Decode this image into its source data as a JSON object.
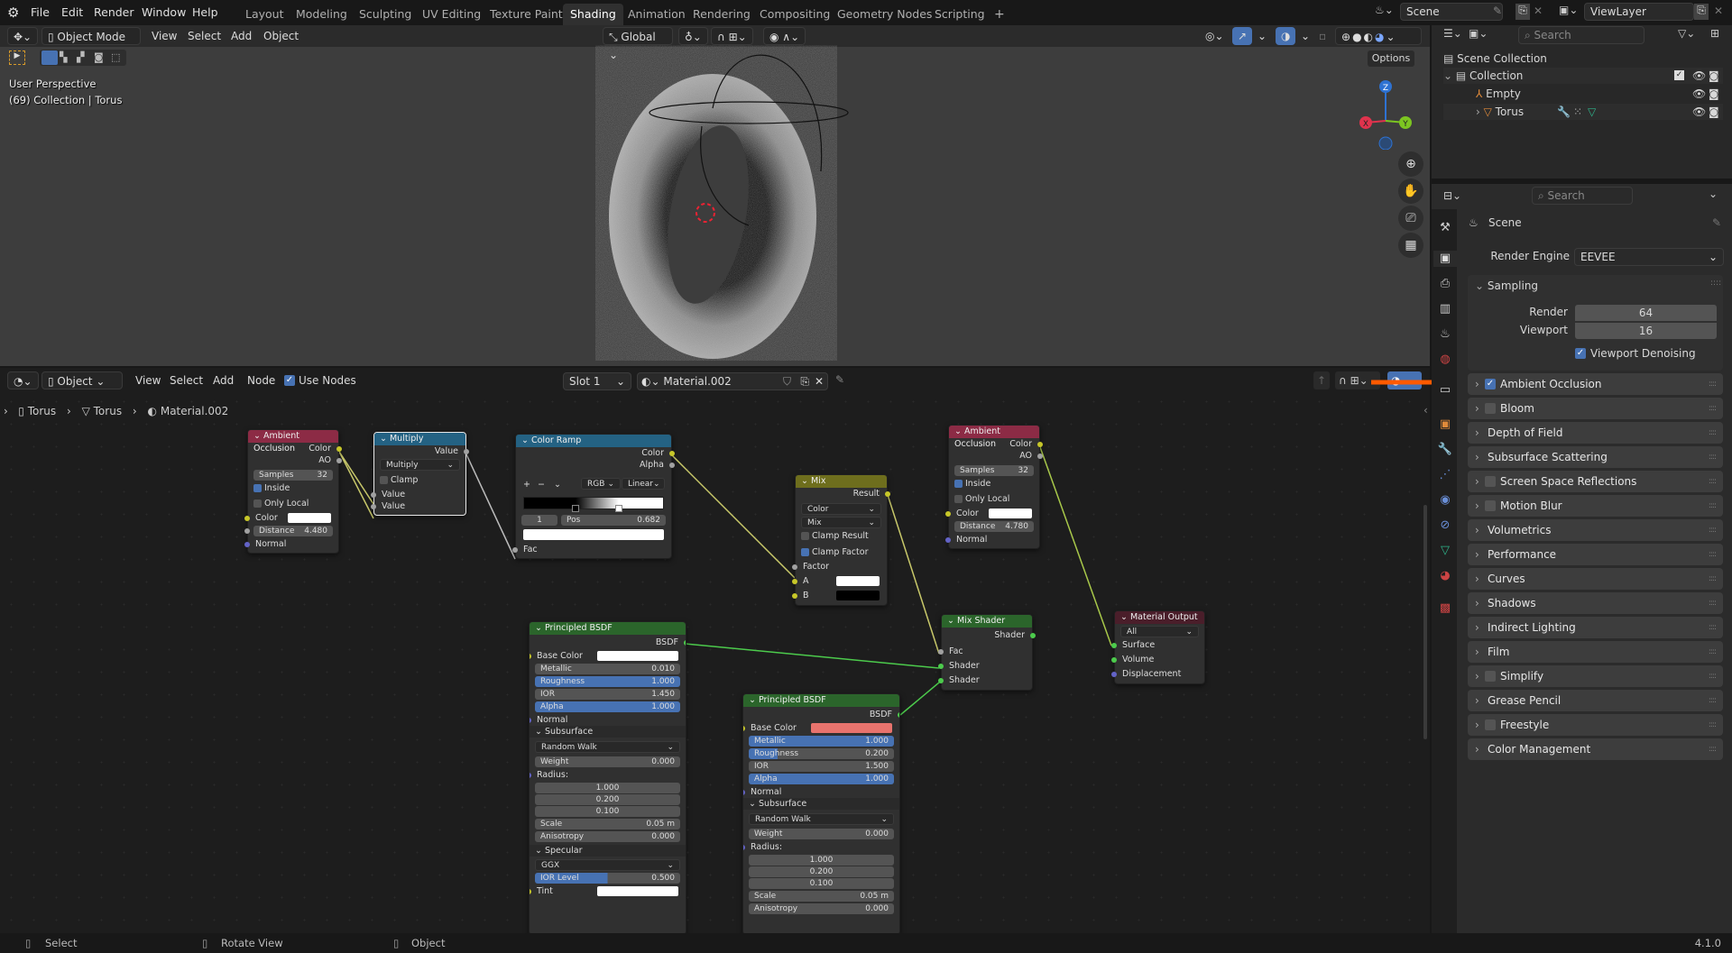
{
  "topbar": {
    "menus": [
      "File",
      "Edit",
      "Render",
      "Window",
      "Help"
    ],
    "workspaces": [
      "Layout",
      "Modeling",
      "Sculpting",
      "UV Editing",
      "Texture Paint",
      "Shading",
      "Animation",
      "Rendering",
      "Compositing",
      "Geometry Nodes",
      "Scripting"
    ],
    "active_workspace": "Shading",
    "add_tab": "+",
    "scene": "Scene",
    "view_layer": "ViewLayer"
  },
  "viewport": {
    "mode": "Object Mode",
    "menus": [
      "View",
      "Select",
      "Add",
      "Object"
    ],
    "transform_orientation": "Global",
    "options_label": "Options",
    "overlay_title": "User Perspective",
    "overlay_subtitle": "(69) Collection | Torus",
    "gizmo_axes": [
      "X",
      "Y",
      "Z"
    ]
  },
  "node_editor": {
    "editor_type": "Object",
    "menus": [
      "View",
      "Select",
      "Add",
      "Node"
    ],
    "use_nodes_label": "Use Nodes",
    "use_nodes_checked": true,
    "slot": "Slot 1",
    "material": "Material.002",
    "breadcrumb": [
      "Torus",
      "Torus",
      "Material.002"
    ],
    "nodes": {
      "ao1": {
        "title": "Ambient Occlusion",
        "out": [
          "Color",
          "AO"
        ],
        "samples_label": "Samples",
        "samples": "32",
        "inside": "Inside",
        "inside_checked": true,
        "only_local": "Only Local",
        "only_local_checked": false,
        "color_label": "Color",
        "distance_label": "Distance",
        "distance": "4.480",
        "normal": "Normal"
      },
      "multiply": {
        "title": "Multiply",
        "out": "Value",
        "op": "Multiply",
        "clamp": "Clamp",
        "in": [
          "Value",
          "Value"
        ]
      },
      "ramp": {
        "title": "Color Ramp",
        "out": [
          "Color",
          "Alpha"
        ],
        "color_mode": "RGB",
        "interp": "Linear",
        "stop_index": "1",
        "pos_label": "Pos",
        "pos": "0.682",
        "fac": "Fac",
        "stops": [
          0.37,
          0.682
        ]
      },
      "mix": {
        "title": "Mix",
        "out": "Result",
        "data_type": "Color",
        "blend": "Mix",
        "clamp_result": "Clamp Result",
        "clamp_factor": "Clamp Factor",
        "factor": "Factor",
        "a": "A",
        "b": "B"
      },
      "ao2": {
        "title": "Ambient Occlusion",
        "out": [
          "Color",
          "AO"
        ],
        "samples_label": "Samples",
        "samples": "32",
        "inside": "Inside",
        "only_local": "Only Local",
        "color_label": "Color",
        "distance_label": "Distance",
        "distance": "4.780",
        "normal": "Normal"
      },
      "mixshader": {
        "title": "Mix Shader",
        "out": "Shader",
        "in": [
          "Fac",
          "Shader",
          "Shader"
        ]
      },
      "output": {
        "title": "Material Output",
        "target": "All",
        "in": [
          "Surface",
          "Volume",
          "Displacement"
        ]
      },
      "bsdf1": {
        "title": "Principled BSDF",
        "out": "BSDF",
        "base_color": "Base Color",
        "base_color_hex": "#ffffff",
        "metallic": "0.010",
        "roughness": "1.000",
        "ior": "1.450",
        "alpha": "1.000",
        "normal": "Normal",
        "subsurface": "Subsurface",
        "ss_method": "Random Walk",
        "weight": "0.000",
        "radius": "Radius:",
        "radius_vals": [
          "1.000",
          "0.200",
          "0.100"
        ],
        "scale": "0.05 m",
        "anisotropy": "0.000",
        "specular": "Specular",
        "distribution": "GGX",
        "ior_level": "0.500",
        "ior_level_frac": 0.5,
        "tint": "Tint",
        "labels": {
          "metallic": "Metallic",
          "roughness": "Roughness",
          "ior": "IOR",
          "alpha": "Alpha",
          "weight": "Weight",
          "scale": "Scale",
          "anisotropy": "Anisotropy",
          "ior_level": "IOR Level"
        }
      },
      "bsdf2": {
        "title": "Principled BSDF",
        "out": "BSDF",
        "base_color": "Base Color",
        "base_color_hex": "#e8736d",
        "metallic": "1.000",
        "roughness": "0.200",
        "ior": "1.500",
        "alpha": "1.000",
        "normal": "Normal",
        "subsurface": "Subsurface",
        "ss_method": "Random Walk",
        "weight": "0.000",
        "radius": "Radius:",
        "radius_vals": [
          "1.000",
          "0.200",
          "0.100"
        ],
        "scale": "0.05 m",
        "anisotropy": "0.000",
        "labels": {
          "metallic": "Metallic",
          "roughness": "Roughness",
          "ior": "IOR",
          "alpha": "Alpha",
          "weight": "Weight",
          "scale": "Scale",
          "anisotropy": "Anisotropy"
        }
      }
    }
  },
  "outliner": {
    "search_placeholder": "Search",
    "items": [
      {
        "label": "Scene Collection",
        "icon": "collection-icon"
      },
      {
        "label": "Collection",
        "icon": "collection-icon"
      },
      {
        "label": "Empty",
        "icon": "empty-icon"
      },
      {
        "label": "Torus",
        "icon": "mesh-icon"
      }
    ]
  },
  "properties": {
    "search_placeholder": "Search",
    "context": "Scene",
    "render_engine_label": "Render Engine",
    "render_engine": "EEVEE",
    "sampling": {
      "title": "Sampling",
      "render_label": "Render",
      "render": "64",
      "viewport_label": "Viewport",
      "viewport": "16",
      "denoise_label": "Viewport Denoising",
      "denoise_checked": true
    },
    "panels": [
      {
        "label": "Ambient Occlusion",
        "checkbox": true,
        "checked": true
      },
      {
        "label": "Bloom",
        "checkbox": true,
        "checked": false
      },
      {
        "label": "Depth of Field",
        "checkbox": false
      },
      {
        "label": "Subsurface Scattering",
        "checkbox": false
      },
      {
        "label": "Screen Space Reflections",
        "checkbox": true,
        "checked": false
      },
      {
        "label": "Motion Blur",
        "checkbox": true,
        "checked": false
      },
      {
        "label": "Volumetrics",
        "checkbox": false
      },
      {
        "label": "Performance",
        "checkbox": false
      },
      {
        "label": "Curves",
        "checkbox": false
      },
      {
        "label": "Shadows",
        "checkbox": false
      },
      {
        "label": "Indirect Lighting",
        "checkbox": false
      },
      {
        "label": "Film",
        "checkbox": false
      },
      {
        "label": "Simplify",
        "checkbox": true,
        "checked": false
      },
      {
        "label": "Grease Pencil",
        "checkbox": false
      },
      {
        "label": "Freestyle",
        "checkbox": true,
        "checked": false
      },
      {
        "label": "Color Management",
        "checkbox": false
      }
    ]
  },
  "statusbar": {
    "select": "Select",
    "rotate": "Rotate View",
    "object": "Object",
    "version": "4.1.0"
  },
  "colors": {
    "accent": "#4772b3",
    "annotation": "#ff5a00",
    "ao_header": "#8c2b45",
    "converter_header": "#246283",
    "mix_header": "#6e6e1d",
    "shader_header": "#2b652b",
    "output_header": "#4a1e2a"
  }
}
